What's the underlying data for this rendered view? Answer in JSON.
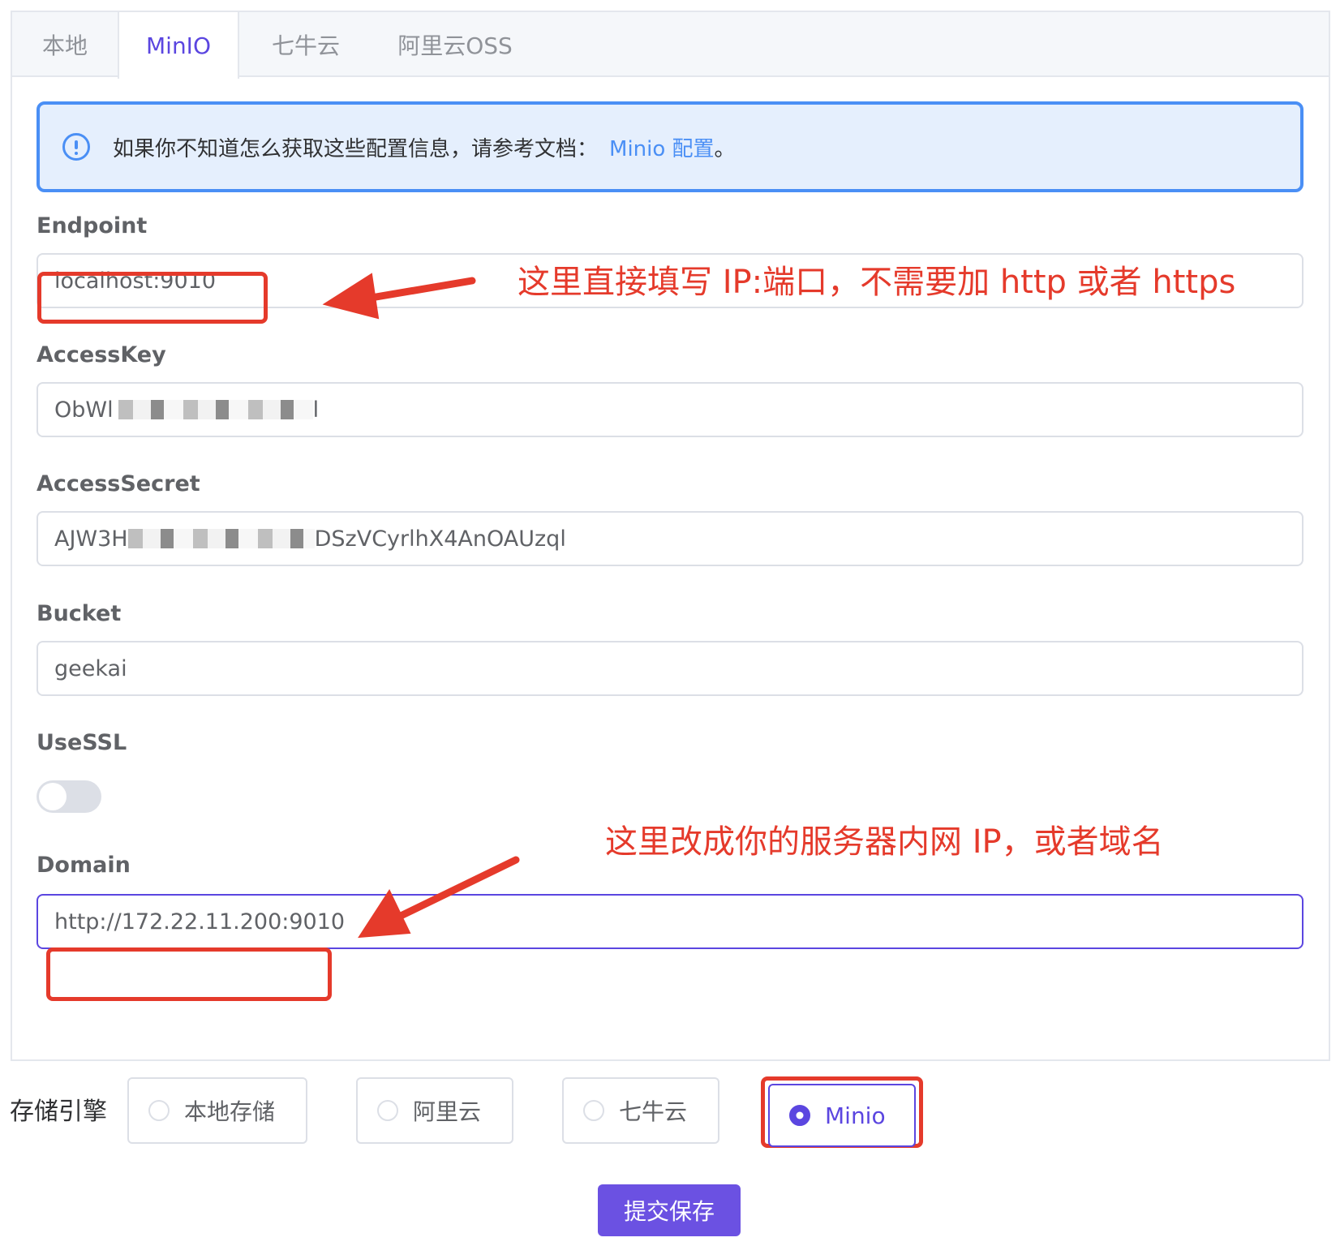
{
  "tabs": [
    {
      "label": "本地",
      "active": false
    },
    {
      "label": "MinIO",
      "active": true
    },
    {
      "label": "七牛云",
      "active": false
    },
    {
      "label": "阿里云OSS",
      "active": false
    }
  ],
  "alert": {
    "icon": "info-circle-icon",
    "text": "如果你不知道怎么获取这些配置信息，请参考文档：",
    "link_text": "Minio 配置",
    "suffix": "。"
  },
  "fields": {
    "endpoint": {
      "label": "Endpoint",
      "value": "localhost:9010"
    },
    "access_key": {
      "label": "AccessKey",
      "value_prefix": "ObWl",
      "value_suffix": "l"
    },
    "access_secret": {
      "label": "AccessSecret",
      "value_prefix": "AJW3H",
      "value_suffix": "DSzVCyrlhX4AnOAUzql"
    },
    "bucket": {
      "label": "Bucket",
      "value": "geekai"
    },
    "use_ssl": {
      "label": "UseSSL",
      "on": false
    },
    "domain": {
      "label": "Domain",
      "value": "http://172.22.11.200:9010"
    }
  },
  "annotations": {
    "endpoint_note": "这里直接填写 IP:端口，不需要加 http 或者 https",
    "domain_note": "这里改成你的服务器内网 IP，或者域名",
    "color": "#e53a2b"
  },
  "storage_engine": {
    "label": "存储引擎",
    "options": [
      "本地存储",
      "阿里云",
      "七牛云",
      "Minio"
    ],
    "selected": "Minio"
  },
  "submit_label": "提交保存",
  "colors": {
    "accent": "#5b46e0",
    "info": "#4a8ff5",
    "button": "#6b51e2"
  }
}
